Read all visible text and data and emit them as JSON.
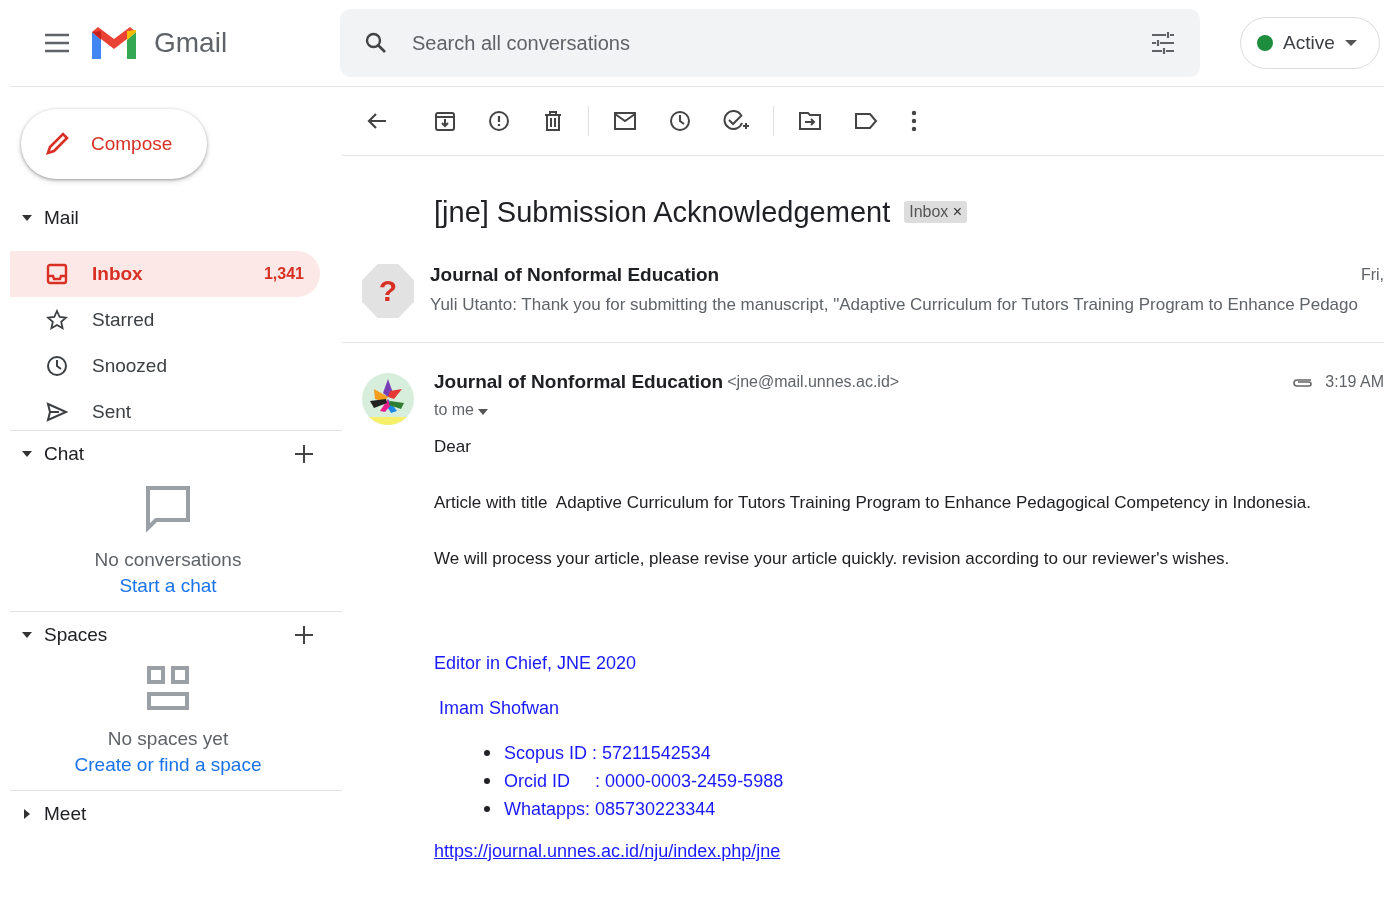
{
  "header": {
    "app_name": "Gmail",
    "search": {
      "placeholder": "Search all conversations"
    },
    "status": {
      "label": "Active"
    }
  },
  "compose": {
    "label": "Compose"
  },
  "mail_section": {
    "label": "Mail",
    "expanded": true,
    "items": [
      {
        "kind": "inbox",
        "label": "Inbox",
        "count": "1,341",
        "selected": true
      },
      {
        "kind": "starred",
        "label": "Starred",
        "selected": false
      },
      {
        "kind": "snoozed",
        "label": "Snoozed",
        "selected": false
      },
      {
        "kind": "sent",
        "label": "Sent",
        "selected": false
      }
    ]
  },
  "chat_section": {
    "label": "Chat",
    "expanded": true,
    "empty_text": "No conversations",
    "link": "Start a chat"
  },
  "spaces_section": {
    "label": "Spaces",
    "expanded": true,
    "empty_text": "No spaces yet",
    "link": "Create or find a space"
  },
  "meet_section": {
    "label": "Meet",
    "expanded": false
  },
  "thread": {
    "subject": "[jne] Submission Acknowledgement",
    "label": {
      "text": "Inbox",
      "remove": "×"
    },
    "messages": [
      {
        "kind": "collapsed",
        "avatar_glyph": "?",
        "sender": "Journal of Nonformal Education",
        "date": "Fri,",
        "snippet": "Yuli Utanto: Thank you for submitting the manuscript, \"Adaptive Curriculum for Tutors Training Program to Enhance Pedago"
      },
      {
        "kind": "expanded",
        "sender": "Journal of Nonformal Education",
        "email": "<jne@mail.unnes.ac.id>",
        "recipient": "to me",
        "time": "3:19 AM",
        "attachment": true,
        "paragraphs": [
          "Dear",
          "Article with title  Adaptive Curriculum for Tutors Training Program to Enhance Pedagogical Competency in Indonesia.",
          "We will process your article, please revise your article quickly. revision according to our reviewer's wishes."
        ],
        "signature": {
          "title": "Editor in Chief, JNE 2020",
          "name": "Imam Shofwan",
          "details": [
            "Scopus ID : 57211542534",
            "Orcid ID     : 0000-0003-2459-5988",
            "Whatapps: 085730223344"
          ],
          "link": "https://journal.unnes.ac.id/nju/index.php/jne"
        }
      }
    ]
  }
}
